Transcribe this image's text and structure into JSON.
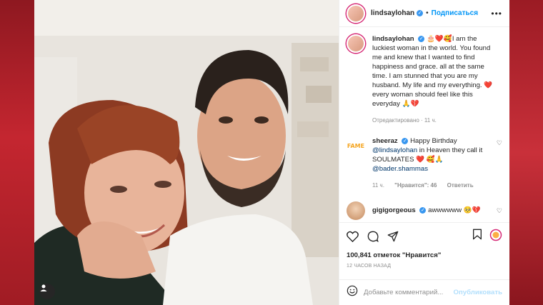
{
  "header": {
    "username": "lindsaylohan",
    "follow_label": "Подписаться",
    "more_label": "•••"
  },
  "caption": {
    "username": "lindsaylohan",
    "emojis": "🎂❤️🥰",
    "text": "I am the luckiest woman in the world. You found me and knew that I wanted to find happiness and grace. all at the same time. I am stunned that you are my husband. My life and my everything. ❤️ every woman should feel like this everyday 🙏💔",
    "edited": "Отредактировано · 11 ч."
  },
  "comments": [
    {
      "username": "sheeraz",
      "avatar_text": "FAME",
      "text_before": "Happy Birthday",
      "mention1": "@lindsaylohan",
      "text_after": " in Heaven they call it SOULMATES ❤️ 🥰🙏",
      "mention2": "@bader.shammas",
      "time": "11 ч.",
      "likes": "\"Нравится\": 46",
      "reply": "Ответить"
    },
    {
      "username": "gigigorgeous",
      "text": "awwwwww 🥺💔"
    }
  ],
  "actions": {
    "likes": "100,841 отметок \"Нравится\"",
    "time": "12 ЧАСОВ НАЗАД"
  },
  "add_comment": {
    "placeholder": "Добавьте комментарий...",
    "publish": "Опубликовать"
  },
  "colors": {
    "background": "#b8202a",
    "accent": "#0095f6",
    "verified": "#3897f0"
  }
}
